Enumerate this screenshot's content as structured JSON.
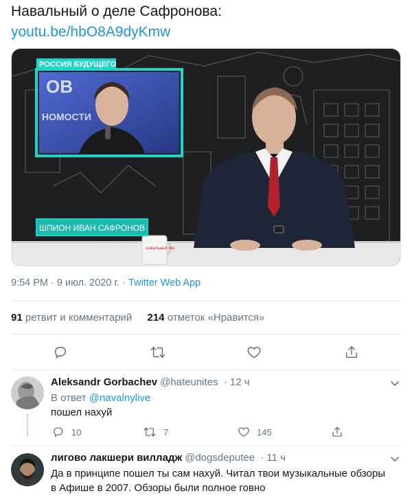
{
  "tweet": {
    "text": "Навальный о деле Сафронова:",
    "link": "youtu.be/hbO8A9dyKmw",
    "media": {
      "brand": "РОССИЯ БУДУЩЕГО",
      "caption": "ШПИОН ИВАН САФРОНОВ",
      "inset_text_top": "ОВ",
      "inset_text_bottom": "НОМОСТИ",
      "cup_text": "навальный live"
    },
    "time": "9:54 PM",
    "date": "9 июл. 2020 г.",
    "dot": "·",
    "app": "Twitter Web App",
    "retweets": {
      "count": "91",
      "label": "ретвит и комментарий"
    },
    "likes": {
      "count": "214",
      "label": "отметок «Нравится»"
    }
  },
  "replies": [
    {
      "name": "Aleksandr Gorbachev",
      "handle": "@hateunites",
      "time": "· 12 ч",
      "reply_to_prefix": "В ответ",
      "reply_to": "@navalnylive",
      "text": "пошел нахуй",
      "stats": {
        "replies": "10",
        "retweets": "7",
        "likes": "145"
      }
    },
    {
      "name": "лигово лакшери вилладж",
      "handle": "@dogsdeputee",
      "time": "· 11 ч",
      "text_line1": "Да в принципе пошел ты сам нахуй. Читал твои музыкальные обзоры",
      "text_line2": "в Афише в 2007. Обзоры были полное говно"
    }
  ],
  "colors": {
    "accent": "#1b95e0",
    "text": "#14171a",
    "muted": "#657786",
    "teal": "#1dd5c8"
  },
  "icons": [
    "reply-icon",
    "retweet-icon",
    "like-icon",
    "share-icon",
    "chevron-down-icon"
  ]
}
